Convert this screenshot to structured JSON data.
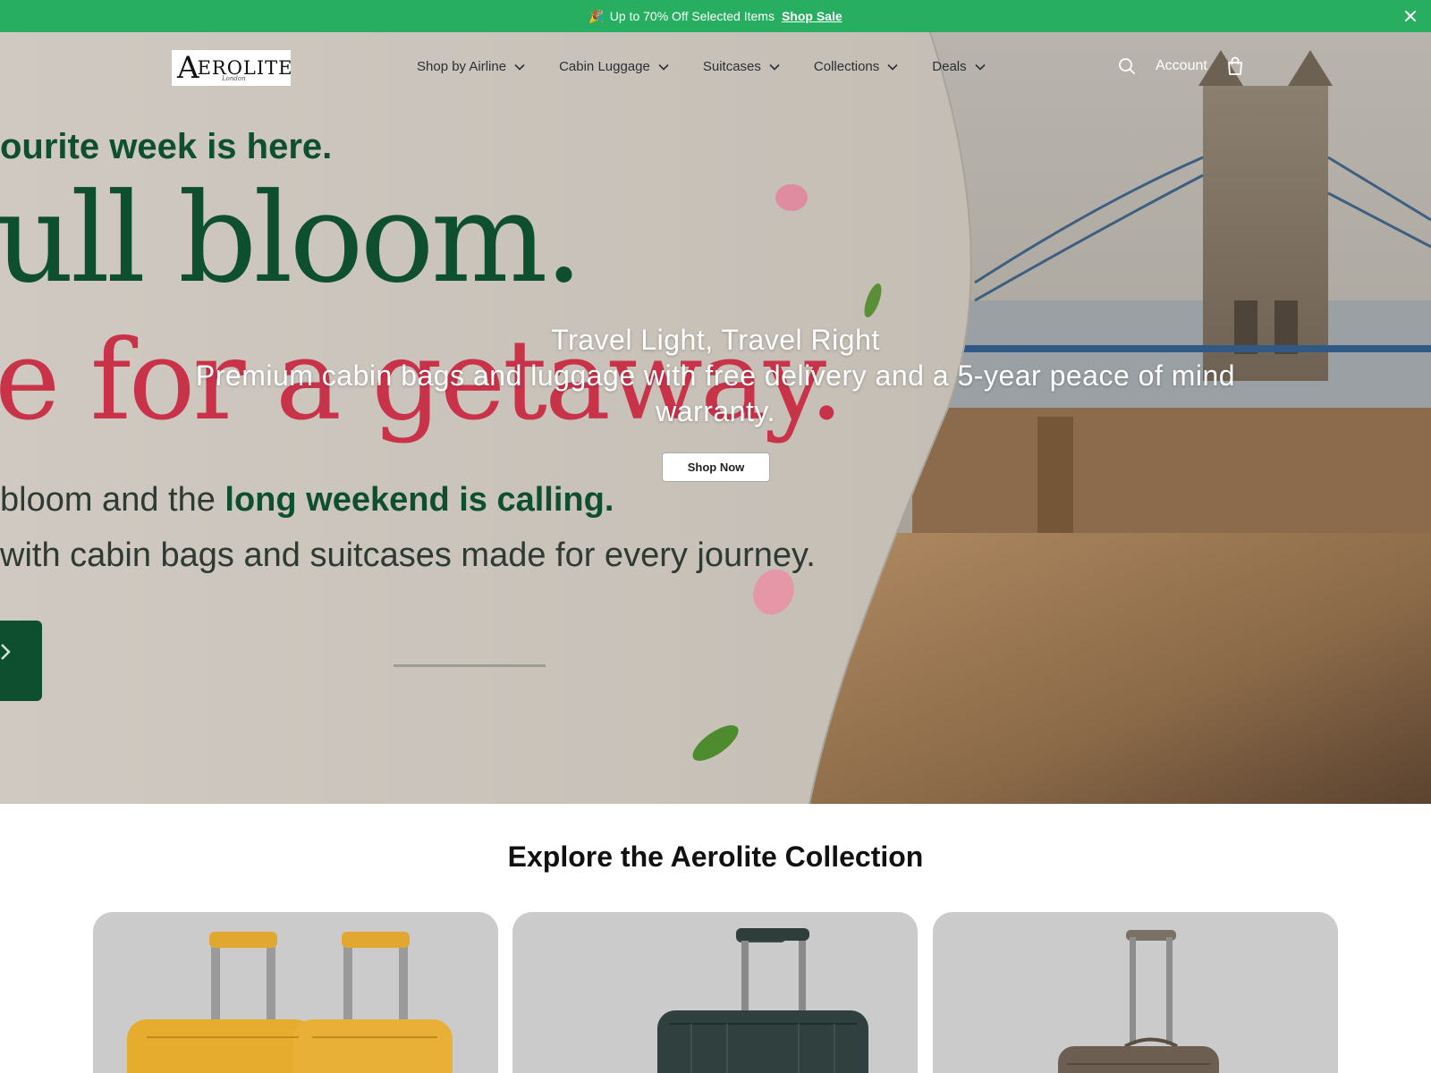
{
  "announcement": {
    "emoji": "🎉",
    "text": "Up to 70% Off Selected Items",
    "link_label": "Shop Sale",
    "close_icon": "close-icon"
  },
  "header": {
    "logo": {
      "letter": "A",
      "word": "EROLITE",
      "sub": "London"
    },
    "nav": [
      {
        "label": "Shop by Airline"
      },
      {
        "label": "Cabin Luggage"
      },
      {
        "label": "Suitcases"
      },
      {
        "label": "Collections"
      },
      {
        "label": "Deals"
      }
    ],
    "account_label": "Account",
    "icons": [
      "search-icon",
      "shopping-bag-icon",
      "chevron-down-icon"
    ]
  },
  "hero": {
    "background_text": {
      "line1": "ourite week is here.",
      "line2": "ull bloom.",
      "line3": "e for a getaway.",
      "line4_a": "bloom and the ",
      "line4_b": "long weekend is calling.",
      "line5": "with cabin bags and suitcases made for every journey."
    },
    "title": "Travel Light, Travel Right",
    "subtitle": "Premium cabin bags and luggage with free delivery and a 5-year peace of mind warranty.",
    "cta_label": "Shop Now"
  },
  "collection": {
    "title": "Explore the Aerolite Collection",
    "cards": [
      {
        "name": "Yellow cabin case pair"
      },
      {
        "name": "Dark green hard shell case"
      },
      {
        "name": "Brown soft case"
      }
    ]
  },
  "colors": {
    "announce_bg": "#27ae60",
    "brand_green": "#0d4f2f",
    "accent_red": "#c9334a"
  }
}
